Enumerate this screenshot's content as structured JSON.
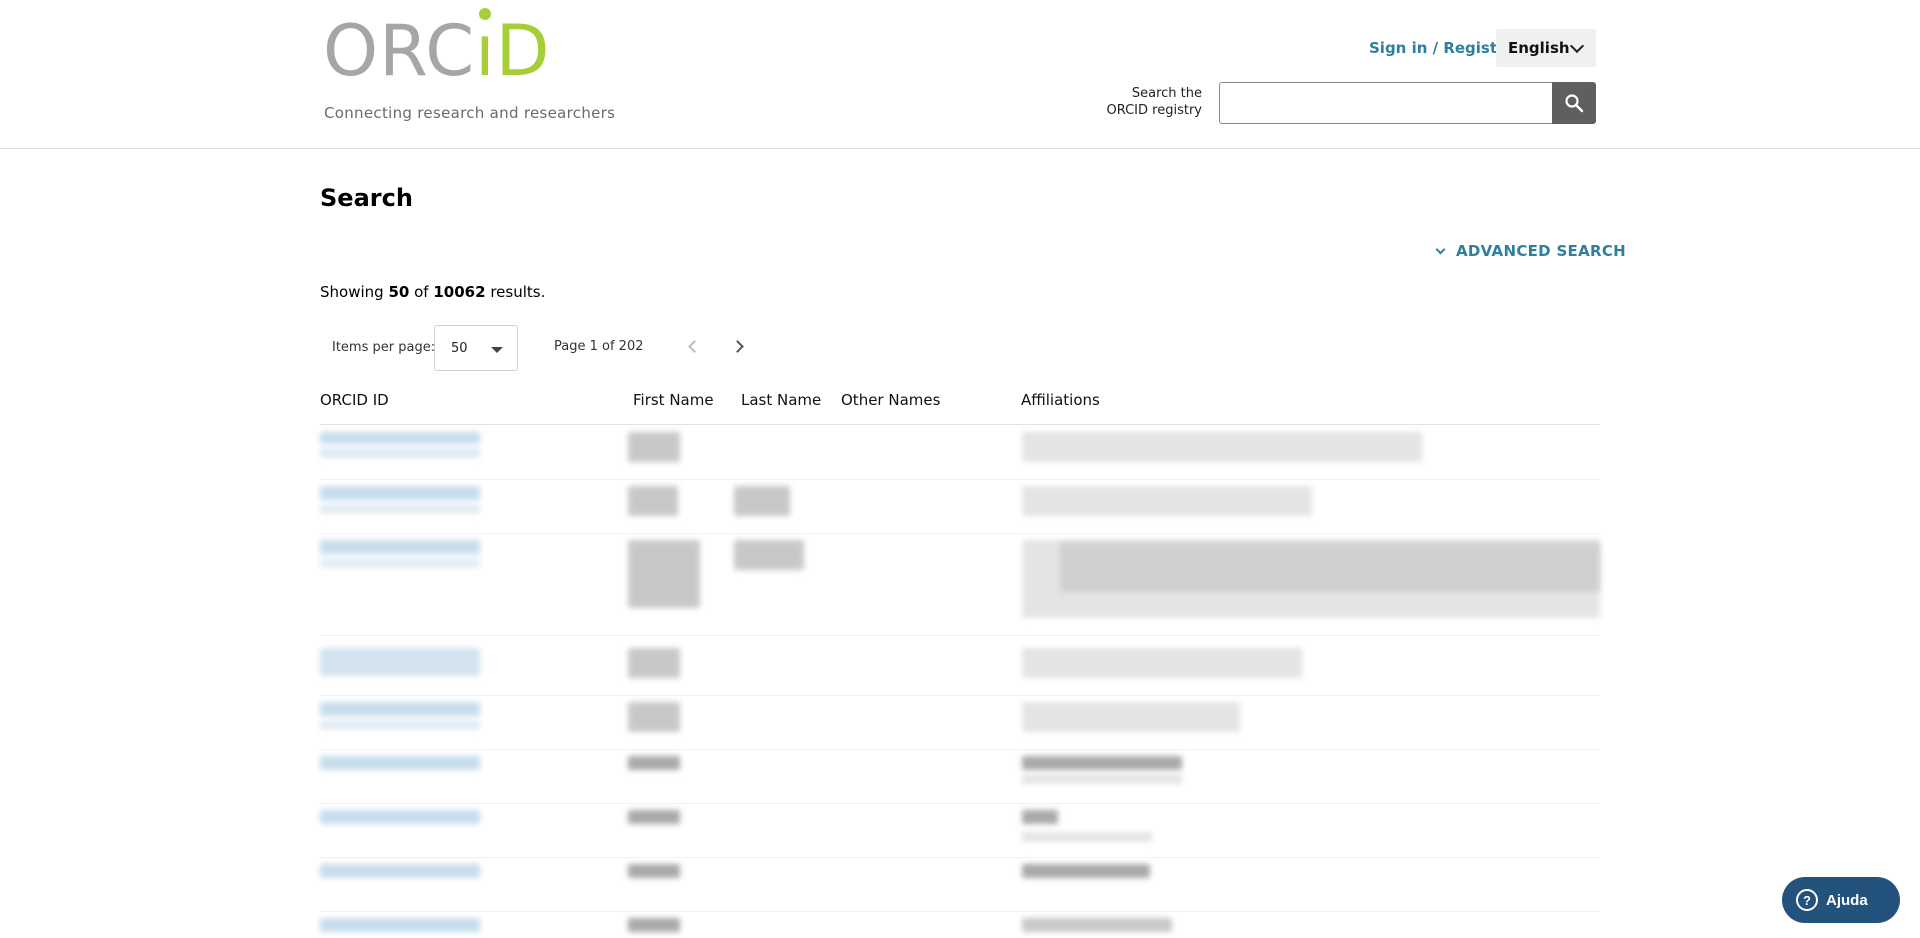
{
  "header": {
    "logo_text": "ORCID",
    "tagline": "Connecting research and researchers",
    "signin_label": "Sign in / Register",
    "language": "English",
    "search_label_line1": "Search the",
    "search_label_line2": "ORCID registry",
    "search_value": ""
  },
  "main": {
    "title": "Search",
    "advanced_search_label": "ADVANCED SEARCH",
    "results": {
      "prefix": "Showing",
      "shown": "50",
      "of": "of",
      "total": "10062",
      "suffix": "results."
    },
    "pager": {
      "items_per_page_label": "Items per page:",
      "items_per_page_value": "50",
      "page_info": "Page 1 of 202"
    },
    "table": {
      "columns": [
        "ORCID ID",
        "First Name",
        "Last Name",
        "Other Names",
        "Affiliations"
      ]
    }
  },
  "help": {
    "label": "Ajuda"
  },
  "colors": {
    "link": "#2e7f9f",
    "logo_green": "#a6ce39",
    "logo_gray": "#a6a6a6",
    "help_bg": "#23527c"
  },
  "icons": {
    "search": "search-icon",
    "language_dropdown": "chevron-down-icon",
    "advanced_search": "chevron-down-icon",
    "prev_page": "chevron-left-icon",
    "next_page": "chevron-right-icon",
    "help": "help-circle-icon"
  }
}
